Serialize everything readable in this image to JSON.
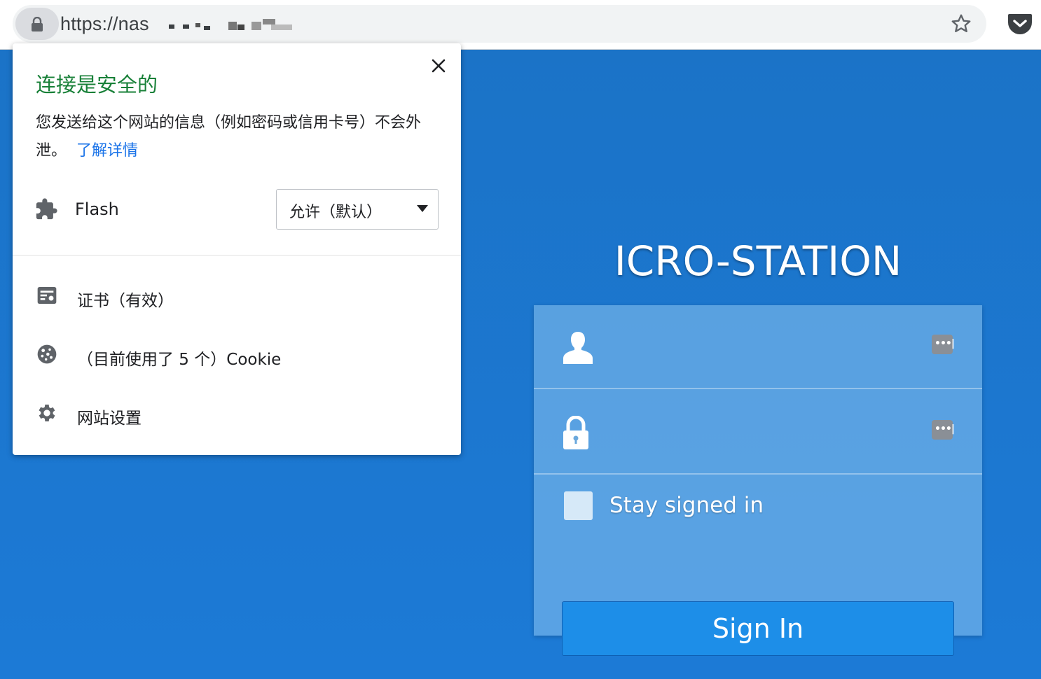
{
  "browser": {
    "url": "https://nas"
  },
  "popup": {
    "title": "连接是安全的",
    "description": "您发送给这个网站的信息（例如密码或信用卡号）不会外泄。",
    "learn_more": "了解详情",
    "flash_label": "Flash",
    "flash_value": "允许（默认）",
    "certificate": "证书（有效）",
    "cookies": "（目前使用了 5 个）Cookie",
    "site_settings": "网站设置"
  },
  "login": {
    "title": "ICRO-STATION",
    "stay_signed_in": "Stay signed in",
    "sign_in": "Sign In"
  }
}
